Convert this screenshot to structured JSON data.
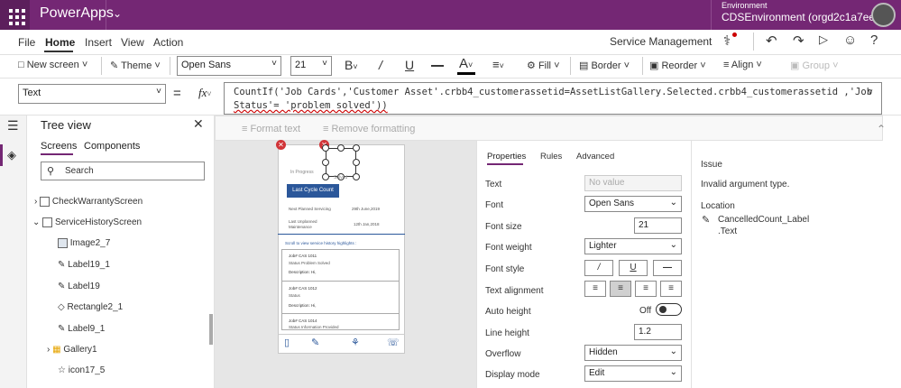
{
  "app": {
    "name": "PowerApps",
    "env_label": "Environment",
    "env_name": "CDSEnvironment (orgd2c1a7ee)"
  },
  "menu": {
    "items": [
      "File",
      "Home",
      "Insert",
      "View",
      "Action"
    ],
    "active": "Home",
    "app_title": "Service Management"
  },
  "toolbar": {
    "new_screen": "New screen",
    "theme": "Theme",
    "font": "Open Sans",
    "font_size": "21",
    "fill": "Fill",
    "border": "Border",
    "reorder": "Reorder",
    "align": "Align",
    "group": "Group"
  },
  "formula": {
    "property": "Text",
    "fx": "fx",
    "line1": "CountIf('Job Cards','Customer Asset'.crbb4_customerassetid=AssetListGallery.Selected.crbb4_customerassetid ,'Job",
    "line2": "Status'= 'problem solved'))",
    "format_text": "Format text",
    "remove_formatting": "Remove formatting"
  },
  "tree": {
    "title": "Tree view",
    "tabs": [
      "Screens",
      "Components"
    ],
    "search_placeholder": "Search",
    "items": [
      {
        "label": "CheckWarrantyScreen",
        "icon": "screen-icon"
      },
      {
        "label": "ServiceHistoryScreen",
        "icon": "screen-icon"
      },
      {
        "label": "Image2_7",
        "icon": "image-icon"
      },
      {
        "label": "Label19_1",
        "icon": "label-icon"
      },
      {
        "label": "Label19",
        "icon": "label-icon"
      },
      {
        "label": "Rectangle2_1",
        "icon": "rectangle-icon"
      },
      {
        "label": "Label9_1",
        "icon": "label-icon"
      },
      {
        "label": "Gallery1",
        "icon": "gallery-icon"
      },
      {
        "label": "icon17_5",
        "icon": "icon-icon"
      }
    ]
  },
  "phone": {
    "in_progress": "In Progress",
    "solved": "Solved",
    "last_cycle_count": "Last Cycle Count",
    "next_planned_label": "Next Planned Servicing",
    "next_planned_value": "29th June,2019",
    "last_unplanned_label": "Last Unplanned Maintenance",
    "last_unplanned_value": "12th Jan,2018",
    "scroll_hint": "Scroll to view service history highlights :",
    "jobs": [
      {
        "job": "Job# CAS 1011",
        "status": "Status  Problem Solved",
        "desc": "Description:  Hi,"
      },
      {
        "job": "Job# CAS 1012",
        "status": "Status",
        "desc": "Description:  Hi,"
      },
      {
        "job": "Job# CAS 1014",
        "status": "Status  Information Provided",
        "desc": ""
      }
    ]
  },
  "props": {
    "tabs": [
      "Properties",
      "Rules",
      "Advanced"
    ],
    "active_tab": "Properties",
    "rows": [
      {
        "label": "Text",
        "value": "No value",
        "type": "text-disabled"
      },
      {
        "label": "Font",
        "value": "Open Sans",
        "type": "dropdown"
      },
      {
        "label": "Font size",
        "value": "21",
        "type": "text"
      },
      {
        "label": "Font weight",
        "value": "Lighter",
        "type": "dropdown"
      },
      {
        "label": "Font style",
        "value": "",
        "type": "buttons"
      },
      {
        "label": "Text alignment",
        "value": "",
        "type": "align"
      },
      {
        "label": "Auto height",
        "value": "Off",
        "type": "toggle"
      },
      {
        "label": "Line height",
        "value": "1.2",
        "type": "text"
      },
      {
        "label": "Overflow",
        "value": "Hidden",
        "type": "dropdown"
      },
      {
        "label": "Display mode",
        "value": "Edit",
        "type": "dropdown"
      }
    ]
  },
  "issue": {
    "title": "Issue",
    "message": "Invalid argument type.",
    "location_title": "Location",
    "location_line1": "CancelledCount_Label",
    "location_line2": ".Text"
  },
  "colors": {
    "topbar": "#742774",
    "accent": "#742774",
    "selected_button": "#2b579a"
  }
}
